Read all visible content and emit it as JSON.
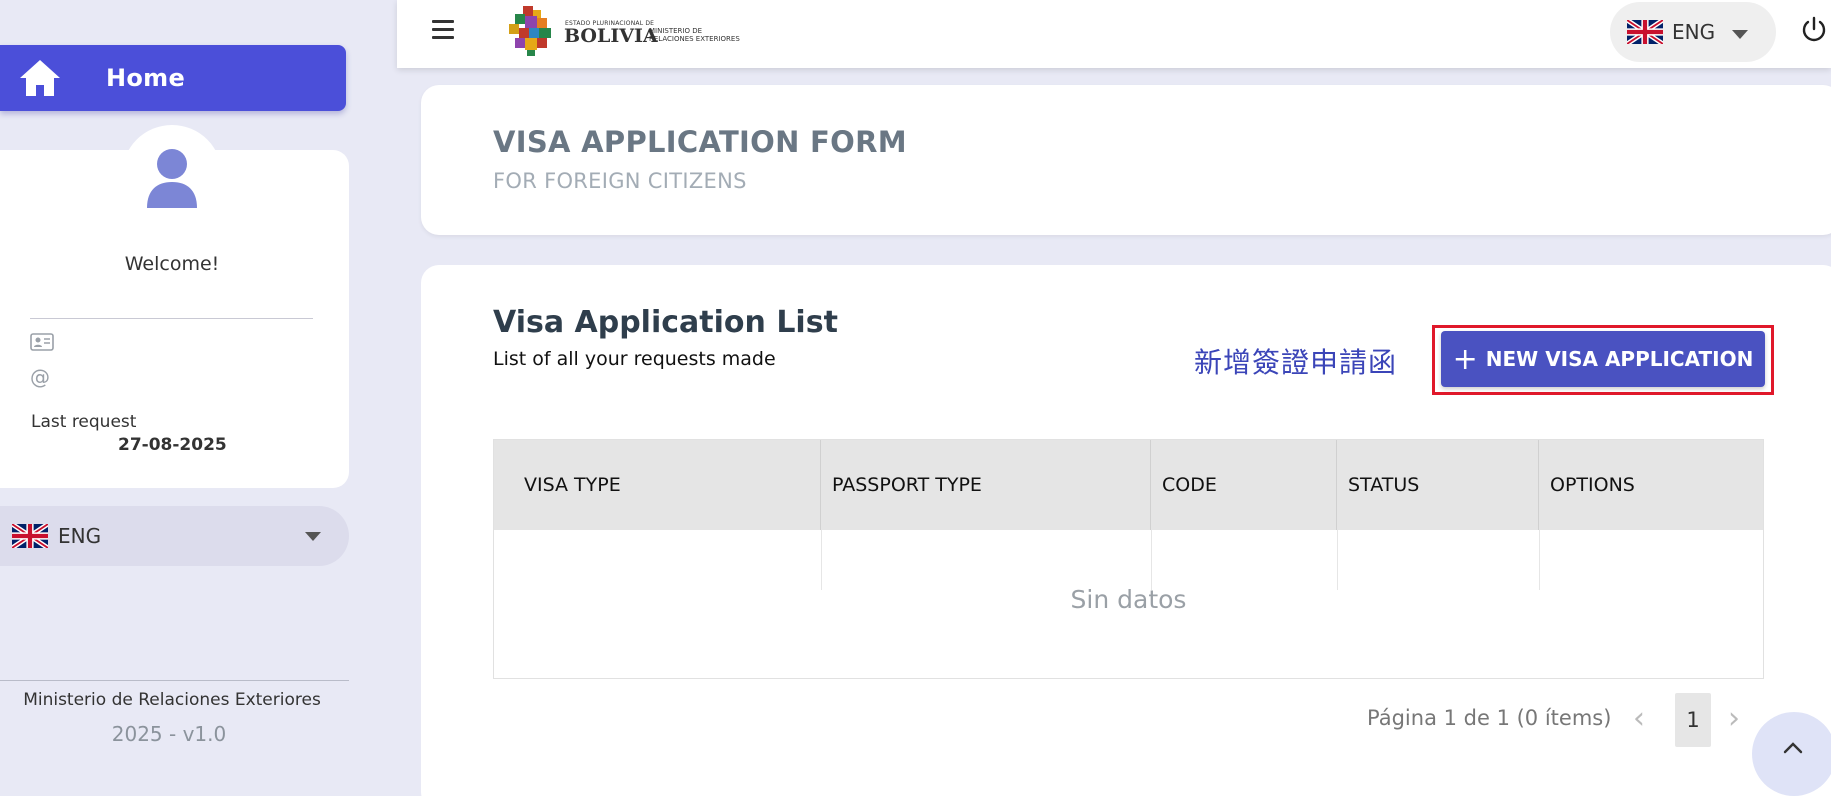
{
  "sidebar": {
    "home_label": "Home",
    "welcome": "Welcome!",
    "last_request_label": "Last request",
    "last_request_date": "27-08-2025",
    "language": "ENG",
    "footer_org": "Ministerio de Relaciones Exteriores",
    "footer_version": "2025 - v1.0"
  },
  "topbar": {
    "logo_small": "ESTADO PLURINACIONAL DE",
    "logo_country": "BOLIVIA",
    "logo_ministry_line1": "MINISTERIO DE",
    "logo_ministry_line2": "RELACIONES EXTERIORES",
    "language": "ENG"
  },
  "header": {
    "title": "VISA APPLICATION FORM",
    "subtitle": "FOR FOREIGN CITIZENS"
  },
  "list": {
    "title": "Visa Application List",
    "subtitle": "List of all your requests made",
    "annotation": "新增簽證申請函",
    "new_button_label": "NEW VISA APPLICATION",
    "columns": [
      "VISA TYPE",
      "PASSPORT TYPE",
      "CODE",
      "STATUS",
      "OPTIONS"
    ],
    "empty_text": "Sin datos",
    "pagination_info": "Página 1 de 1 (0 ítems)",
    "current_page": "1"
  },
  "colors": {
    "accent": "#4b4fd9",
    "button": "#4a52c1",
    "highlight_frame": "#e0182a",
    "background": "#e8e9f5"
  },
  "icons": {
    "home": "home-icon",
    "avatar": "user-icon",
    "id_card": "id-card-icon",
    "email": "at-icon",
    "menu": "hamburger-icon",
    "power": "power-icon",
    "scroll_top": "chevron-up-icon",
    "flag": "uk-flag-icon"
  }
}
